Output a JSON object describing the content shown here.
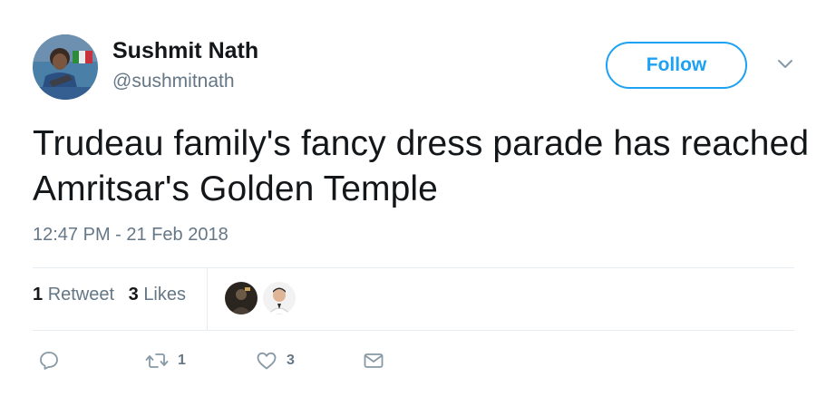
{
  "user": {
    "name": "Sushmit Nath",
    "handle": "@sushmitnath"
  },
  "follow_button": {
    "label": "Follow"
  },
  "tweet": {
    "text": "Trudeau family's fancy dress parade has reached Amritsar's Golden Temple",
    "timestamp": "12:47 PM - 21 Feb 2018"
  },
  "stats": {
    "retweets_count": "1",
    "retweets_label": "Retweet",
    "likes_count": "3",
    "likes_label": "Likes"
  },
  "actions": {
    "reply_icon": "reply-icon",
    "retweet_icon": "retweet-icon",
    "retweet_count": "1",
    "like_icon": "heart-icon",
    "like_count": "3",
    "dm_icon": "envelope-icon"
  },
  "colors": {
    "accent": "#1da1f2",
    "text": "#14171a",
    "secondary": "#657786",
    "divider": "#e6ecf0"
  }
}
